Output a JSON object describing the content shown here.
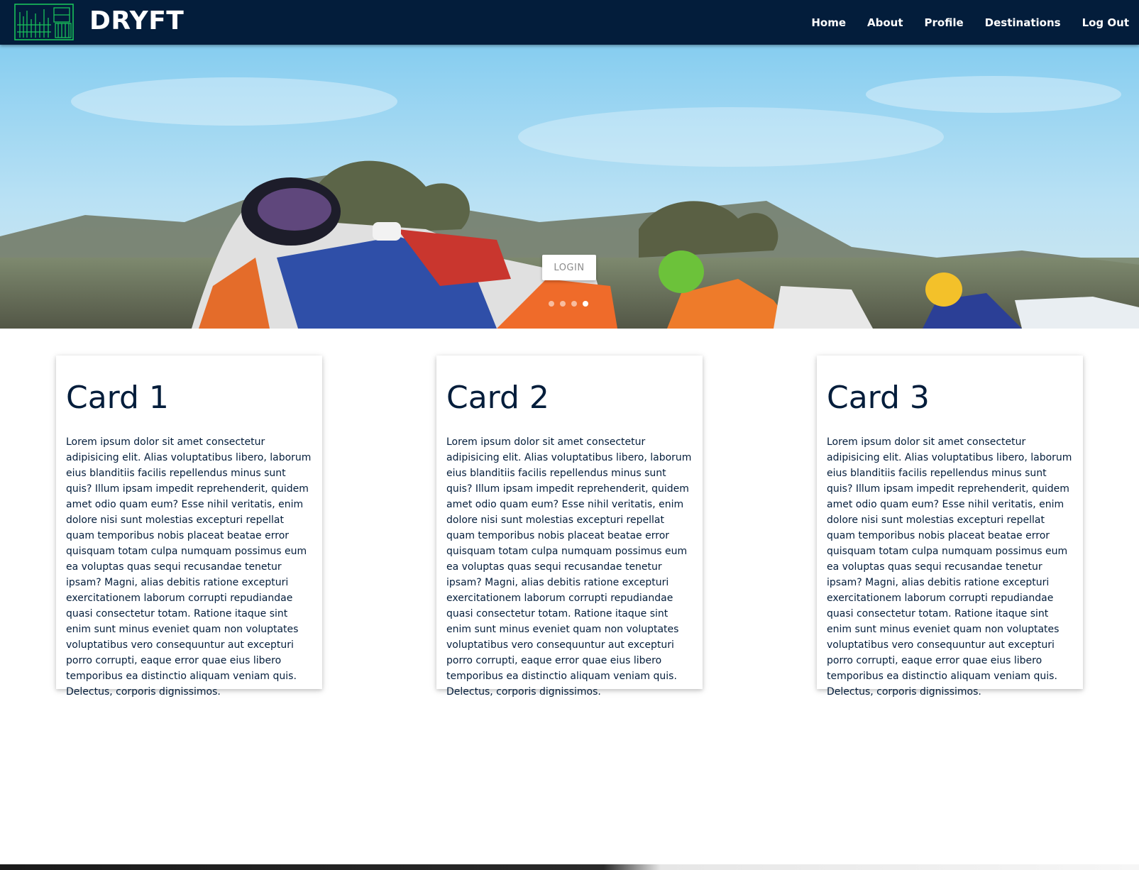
{
  "header": {
    "logo_icon": "city-skyline-logo-icon",
    "brand": "DRYFT",
    "nav": [
      {
        "label": "Home"
      },
      {
        "label": "About"
      },
      {
        "label": "Profile"
      },
      {
        "label": "Destinations"
      },
      {
        "label": "Log Out"
      }
    ]
  },
  "hero": {
    "image": "motorcycle-racing-photo",
    "login_label": "LOGIN",
    "slide_count": 4,
    "active_slide": 4
  },
  "cards": [
    {
      "title": "Card 1",
      "body": "Lorem ipsum dolor sit amet consectetur adipisicing elit. Alias voluptatibus libero, laborum eius blanditiis facilis repellendus minus sunt quis? Illum ipsam impedit reprehenderit, quidem amet odio quam eum? Esse nihil veritatis, enim dolore nisi sunt molestias excepturi repellat quam temporibus nobis placeat beatae error quisquam totam culpa numquam possimus eum ea voluptas quas sequi recusandae tenetur ipsam? Magni, alias debitis ratione excepturi exercitationem laborum corrupti repudiandae quasi consectetur totam. Ratione itaque sint enim sunt minus eveniet quam non voluptates voluptatibus vero consequuntur aut excepturi porro corrupti, eaque error quae eius libero temporibus ea distinctio aliquam veniam quis. Delectus, corporis dignissimos."
    },
    {
      "title": "Card 2",
      "body": "Lorem ipsum dolor sit amet consectetur adipisicing elit. Alias voluptatibus libero, laborum eius blanditiis facilis repellendus minus sunt quis? Illum ipsam impedit reprehenderit, quidem amet odio quam eum? Esse nihil veritatis, enim dolore nisi sunt molestias excepturi repellat quam temporibus nobis placeat beatae error quisquam totam culpa numquam possimus eum ea voluptas quas sequi recusandae tenetur ipsam? Magni, alias debitis ratione excepturi exercitationem laborum corrupti repudiandae quasi consectetur totam. Ratione itaque sint enim sunt minus eveniet quam non voluptates voluptatibus vero consequuntur aut excepturi porro corrupti, eaque error quae eius libero temporibus ea distinctio aliquam veniam quis. Delectus, corporis dignissimos."
    },
    {
      "title": "Card 3",
      "body": "Lorem ipsum dolor sit amet consectetur adipisicing elit. Alias voluptatibus libero, laborum eius blanditiis facilis repellendus minus sunt quis? Illum ipsam impedit reprehenderit, quidem amet odio quam eum? Esse nihil veritatis, enim dolore nisi sunt molestias excepturi repellat quam temporibus nobis placeat beatae error quisquam totam culpa numquam possimus eum ea voluptas quas sequi recusandae tenetur ipsam? Magni, alias debitis ratione excepturi exercitationem laborum corrupti repudiandae quasi consectetur totam. Ratione itaque sint enim sunt minus eveniet quam non voluptates voluptatibus vero consequuntur aut excepturi porro corrupti, eaque error quae eius libero temporibus ea distinctio aliquam veniam quis. Delectus, corporis dignissimos."
    }
  ],
  "colors": {
    "navbar_bg": "#031d3b",
    "text_primary": "#031d3b",
    "logo_green": "#19c25a",
    "login_text": "#8b8b8b"
  }
}
